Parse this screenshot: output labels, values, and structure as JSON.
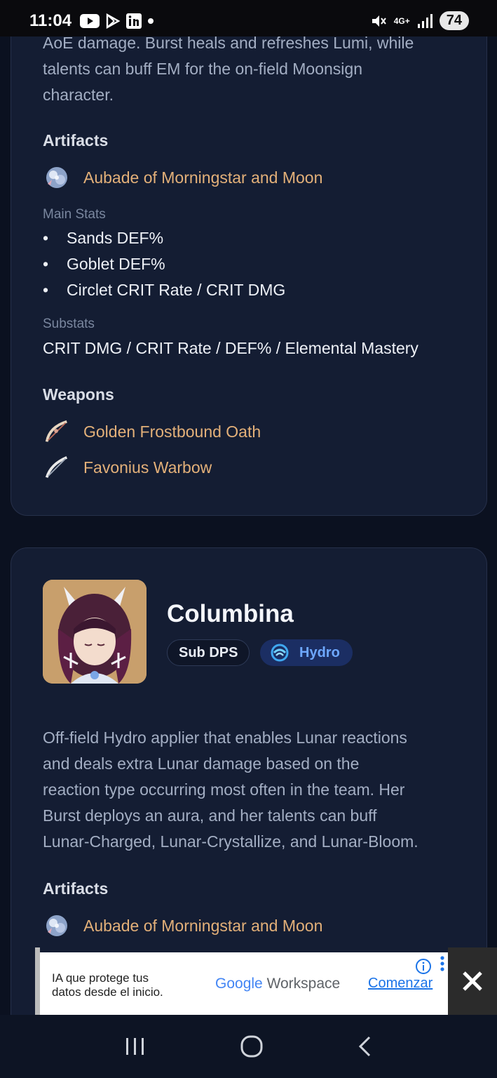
{
  "status_bar": {
    "time": "11:04",
    "network": "4G+",
    "battery": "74"
  },
  "card1": {
    "desc_lines": [
      "AoE damage. Burst heals and refreshes Lumi, while",
      "talents can buff EM for the on-field Moonsign",
      "character."
    ],
    "artifacts_title": "Artifacts",
    "artifact_name": "Aubade of Morningstar and Moon",
    "main_stats_label": "Main Stats",
    "main_stats": [
      "Sands DEF%",
      "Goblet DEF%",
      "Circlet CRIT Rate / CRIT DMG"
    ],
    "substats_label": "Substats",
    "substats": "CRIT DMG / CRIT Rate / DEF% / Elemental Mastery",
    "weapons_title": "Weapons",
    "weapons": [
      "Golden Frostbound Oath",
      "Favonius Warbow"
    ]
  },
  "card2": {
    "name": "Columbina",
    "role": "Sub DPS",
    "element": "Hydro",
    "element_color": "#6ea8ff",
    "desc_lines": [
      "Off-field Hydro applier that enables Lunar reactions",
      "and deals extra Lunar damage based on the",
      "reaction type occurring most often in the team. Her",
      "Burst deploys an aura, and her talents can buff",
      "Lunar-Charged, Lunar-Crystallize, and Lunar-Bloom."
    ],
    "artifacts_title": "Artifacts",
    "artifact_name": "Aubade of Morningstar and Moon"
  },
  "ad": {
    "tagline_line1": "IA que protege tus",
    "tagline_line2": "datos desde el inicio.",
    "brand_google": "Google",
    "brand_product": "Workspace",
    "cta": "Comenzar"
  },
  "colors": {
    "background": "#0b1120",
    "card": "#141d33",
    "item_gold": "#e3b079",
    "hydro_blue": "#6ea8ff"
  }
}
